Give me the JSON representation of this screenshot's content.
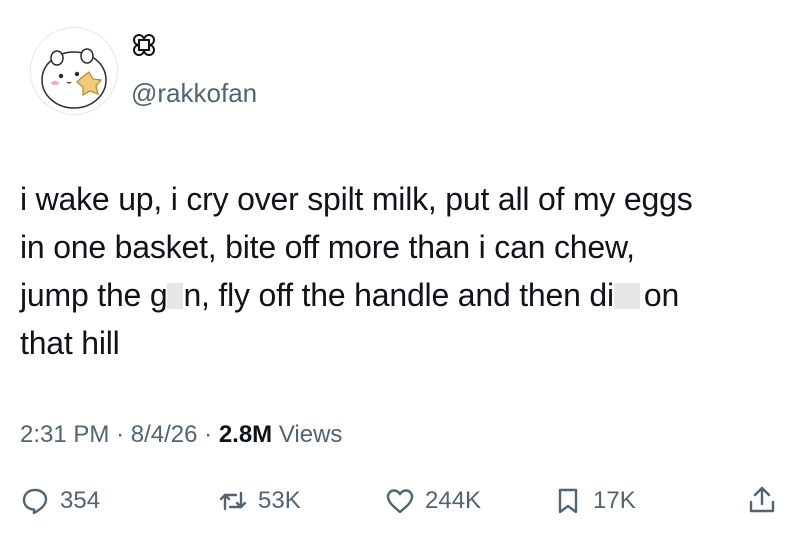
{
  "author": {
    "handle": "@rakkofan",
    "name_glyph_icon": "clover-glyph-icon",
    "avatar_icon": "chiikawa-avatar-icon"
  },
  "tweet": {
    "line1": "i wake up, i cry over spilt milk, put all of my eggs",
    "line2": "in one basket, bite off more than i can chew,",
    "line3_a": "jump the g",
    "line3_b": "n, fly off the handle and then di",
    "line3_c": "on",
    "line4": "that hill"
  },
  "meta": {
    "time": "2:31 PM",
    "sep1": "·",
    "date": "8/4/26",
    "sep2": "·",
    "views_count": "2.8M",
    "views_label": "Views"
  },
  "actions": {
    "replies": "354",
    "reposts": "53K",
    "likes": "244K",
    "bookmarks": "17K"
  },
  "colors": {
    "text": "#0f1419",
    "secondary": "#536471",
    "border": "#e7e7e7"
  }
}
